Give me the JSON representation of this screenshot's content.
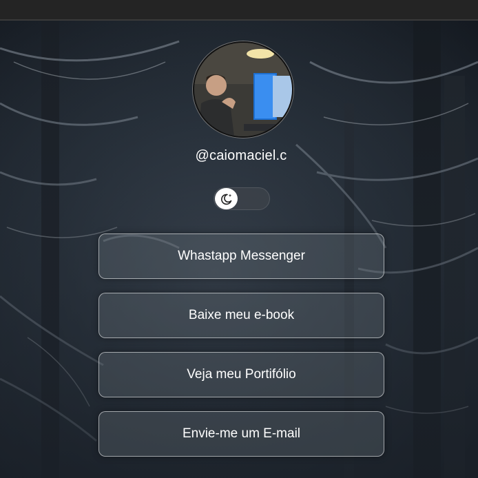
{
  "profile": {
    "username": "@caiomaciel.c",
    "photo_alt": "profile-photo"
  },
  "theme_toggle": {
    "icon": "moon-stars-icon",
    "state": "off"
  },
  "links": [
    {
      "label": "Whastapp Messenger"
    },
    {
      "label": "Baixe meu e-book"
    },
    {
      "label": "Veja meu Portifólio"
    },
    {
      "label": "Envie-me um E-mail"
    }
  ],
  "colors": {
    "text": "#ffffff",
    "button_border": "#d9dde2",
    "toggle_track": "#3c424a",
    "knob": "#ffffff"
  }
}
